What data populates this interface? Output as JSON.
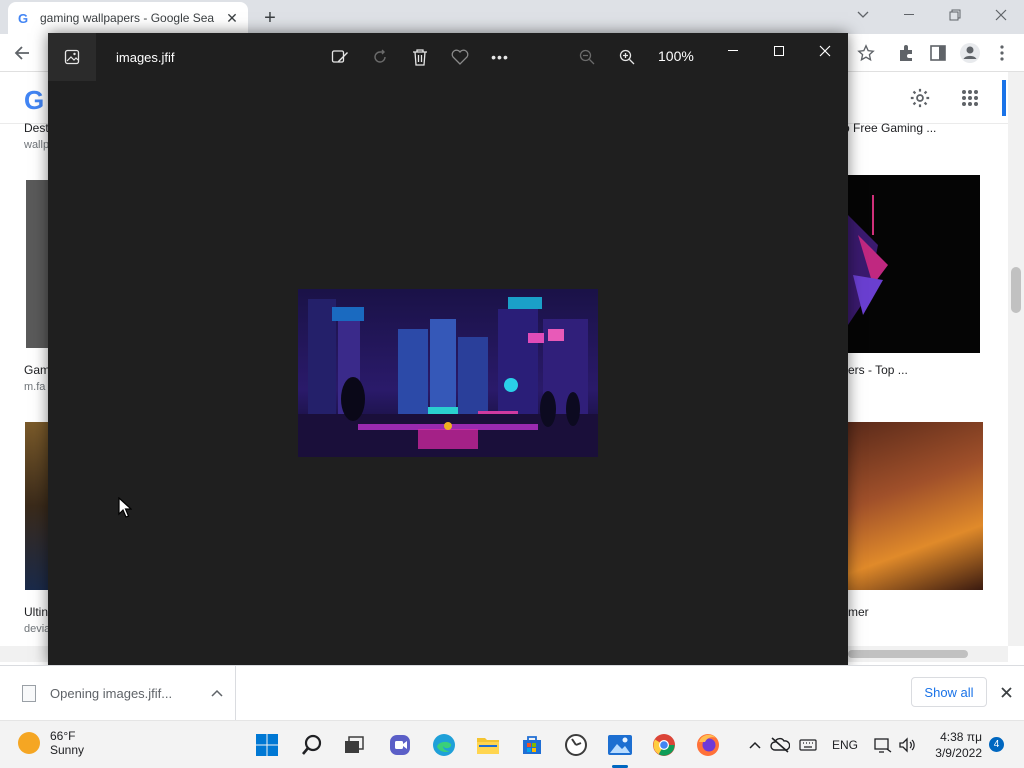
{
  "browser": {
    "tab_title": "gaming wallpapers - Google Sea",
    "tab_close": "✕",
    "new_tab": "+"
  },
  "google_page": {
    "result_left_1_title": "Dest",
    "result_left_1_sub": "wallp",
    "result_right_1_title": "o Free Gaming ...",
    "result_left_2_title": "Gam",
    "result_left_2_sub": "m.fa",
    "result_right_2_title": "ers - Top ...",
    "result_left_3_title": "Ultin",
    "result_left_3_sub": "devia",
    "result_right_3_title": "mer"
  },
  "viewer": {
    "filename": "images.jfif",
    "zoom_level": "100%",
    "more_label": "•••"
  },
  "downloads": {
    "item_label": "Opening images.jfif...",
    "show_all": "Show all"
  },
  "taskbar": {
    "weather_temp": "66°F",
    "weather_desc": "Sunny",
    "language": "ENG",
    "time": "4:38 πμ",
    "date": "3/9/2022",
    "notifications": "4"
  },
  "colors": {
    "viewer_bg": "#1f1f1f",
    "accent": "#0067c0",
    "link_blue": "#1a73e8"
  },
  "icons": [
    "google-favicon",
    "back-icon",
    "star-icon",
    "extensions-icon",
    "sidepanel-icon",
    "profile-icon",
    "menu-dots-icon",
    "settings-icon",
    "apps-grid-icon",
    "edit-image-icon",
    "rotate-icon",
    "delete-icon",
    "favorite-icon",
    "zoom-out-icon",
    "zoom-in-icon",
    "minimize-icon",
    "maximize-icon",
    "close-icon",
    "windows-start-icon",
    "search-icon",
    "file-explorer-icon",
    "teams-icon",
    "edge-icon",
    "folder-icon",
    "store-icon",
    "clock-app-icon",
    "photos-icon",
    "chrome-icon",
    "firefox-icon",
    "chevron-up-icon",
    "cloud-off-icon",
    "keyboard-icon",
    "network-icon",
    "volume-icon"
  ]
}
